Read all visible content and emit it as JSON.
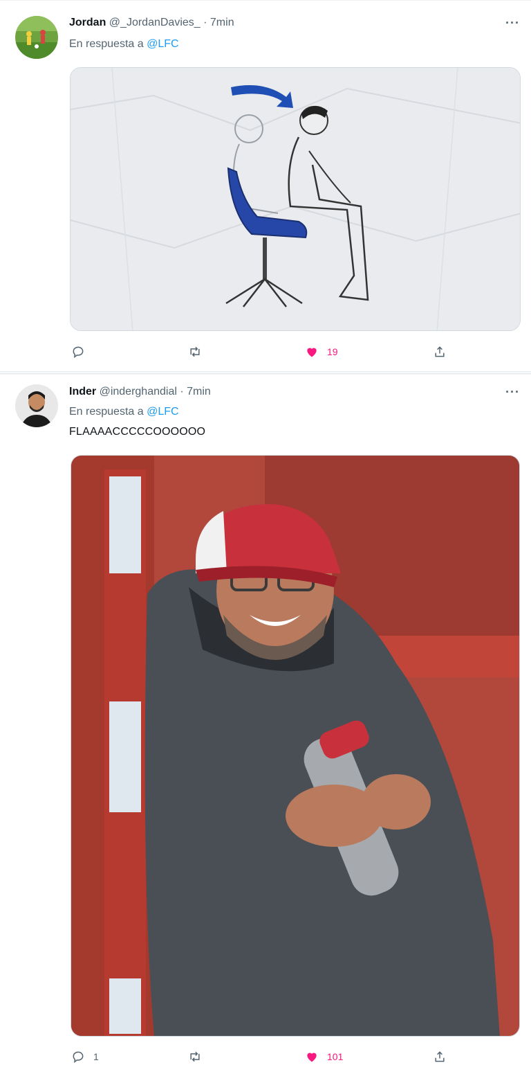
{
  "tweets": [
    {
      "name": "Jordan",
      "handle": "@_JordanDavies_",
      "separator": "·",
      "time": "7min",
      "reply_prefix": "En respuesta a",
      "reply_mention": "@LFC",
      "text": "",
      "actions": {
        "replies": "",
        "retweets": "",
        "likes": "19",
        "liked": true
      }
    },
    {
      "name": "Inder",
      "handle": "@inderghandial",
      "separator": "·",
      "time": "7min",
      "reply_prefix": "En respuesta a",
      "reply_mention": "@LFC",
      "text": "FLAAAACCCCCOOOOOO",
      "actions": {
        "replies": "1",
        "retweets": "",
        "likes": "101",
        "liked": true
      }
    }
  ],
  "more_glyph": "···",
  "colors": {
    "like": "#f91880",
    "link": "#1d9bf0",
    "muted": "#536471",
    "text": "#0f1419"
  },
  "icons": [
    "reply-icon",
    "retweet-icon",
    "heart-icon",
    "share-icon",
    "more-icon"
  ]
}
